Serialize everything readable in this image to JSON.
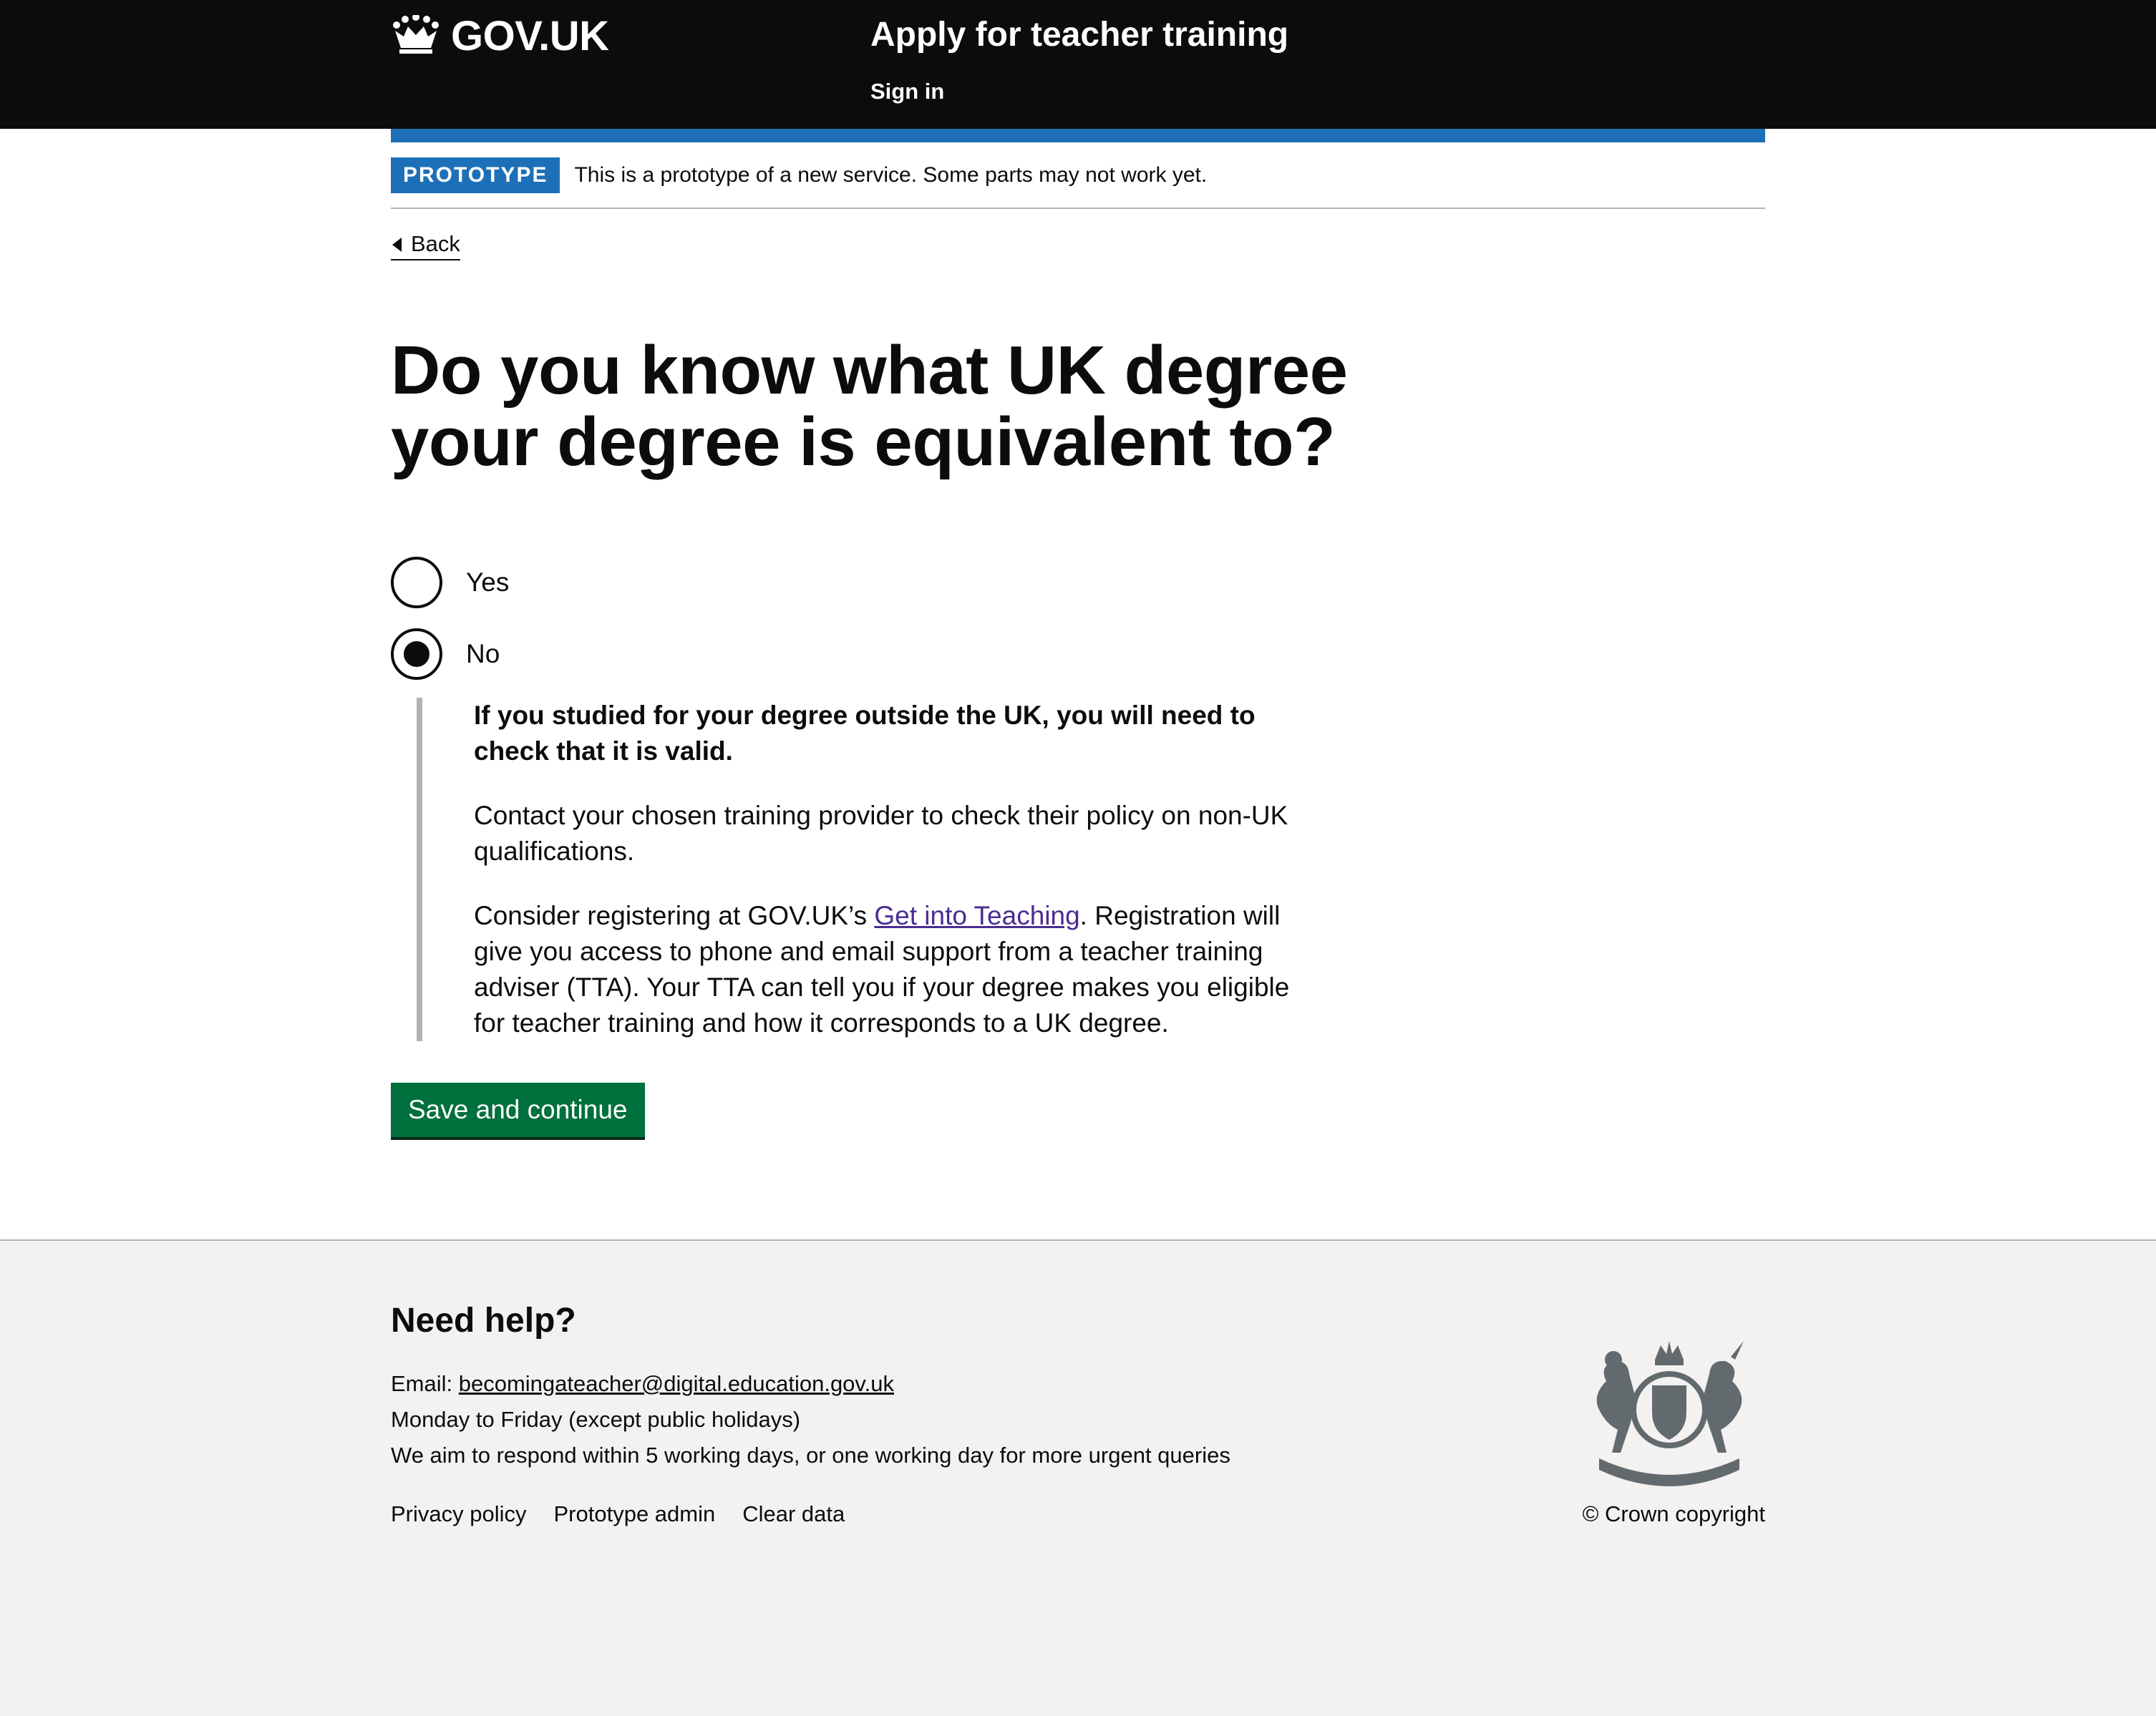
{
  "header": {
    "logo_text": "GOV.UK",
    "service_name": "Apply for teacher training",
    "sign_in": "Sign in",
    "logo_icon": "crown-icon"
  },
  "phase_banner": {
    "tag": "PROTOTYPE",
    "text": "This is a prototype of a new service. Some parts may not work yet."
  },
  "back_link": "Back",
  "question": {
    "heading_line1": "Do you know what UK degree",
    "heading_line2": "your degree is equivalent to?",
    "options": [
      {
        "label": "Yes",
        "checked": false
      },
      {
        "label": "No",
        "checked": true
      }
    ]
  },
  "conditional": {
    "bold_text": "If you studied for your degree outside the UK, you will need to check that it is valid.",
    "paragraph1": "Contact your chosen training provider to check their policy on non-UK qualifications.",
    "paragraph2_before": "Consider registering at GOV.UK’s ",
    "paragraph2_link": "Get into Teaching",
    "paragraph2_after": ". Registration will give you access to phone and email support from a teacher training adviser (TTA). Your TTA can tell you if your degree makes you eligible for teacher training and how it corresponds to a UK degree."
  },
  "submit_button": "Save and continue",
  "footer": {
    "heading": "Need help?",
    "email_label": "Email: ",
    "email": "becomingateacher@digital.education.gov.uk",
    "hours": "Monday to Friday (except public holidays)",
    "response": "We aim to respond within 5 working days, or one working day for more urgent queries",
    "links": [
      "Privacy policy",
      "Prototype admin",
      "Clear data"
    ],
    "copyright": "© Crown copyright",
    "crest_icon": "royal-coat-of-arms-icon"
  },
  "colors": {
    "header_bg": "#0b0c0c",
    "brand_blue": "#1d70b8",
    "button_green": "#00703c",
    "visited_link": "#4c2c92",
    "footer_bg": "#f3f2f1"
  }
}
